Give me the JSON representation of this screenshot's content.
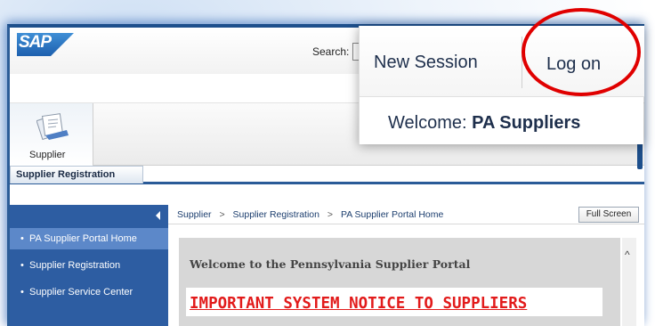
{
  "header": {
    "logo_text": "SAP",
    "search_label": "Search:"
  },
  "callout": {
    "new_session": "New Session",
    "log_on": "Log on",
    "welcome_prefix": "Welcome:",
    "welcome_user": "PA Suppliers"
  },
  "top_nav": {
    "supplier_label": "Supplier"
  },
  "second_nav": {
    "tab_label": "Supplier Registration"
  },
  "left_nav": {
    "items": [
      {
        "label": "PA Supplier Portal Home",
        "active": true
      },
      {
        "label": "Supplier Registration",
        "active": false
      },
      {
        "label": "Supplier Service Center",
        "active": false
      }
    ]
  },
  "breadcrumb": {
    "items": [
      "Supplier",
      "Supplier Registration",
      "PA Supplier Portal Home"
    ],
    "separator": ">"
  },
  "fullscreen_label": "Full Screen",
  "content": {
    "welcome": "Welcome to the Pennsylvania Supplier Portal",
    "notice": "IMPORTANT SYSTEM NOTICE TO SUPPLIERS"
  },
  "colors": {
    "portal_blue": "#2d5da2",
    "active_nav": "#5c88c9",
    "notice_red": "#e21b1b",
    "highlight_circle": "#e00000"
  }
}
